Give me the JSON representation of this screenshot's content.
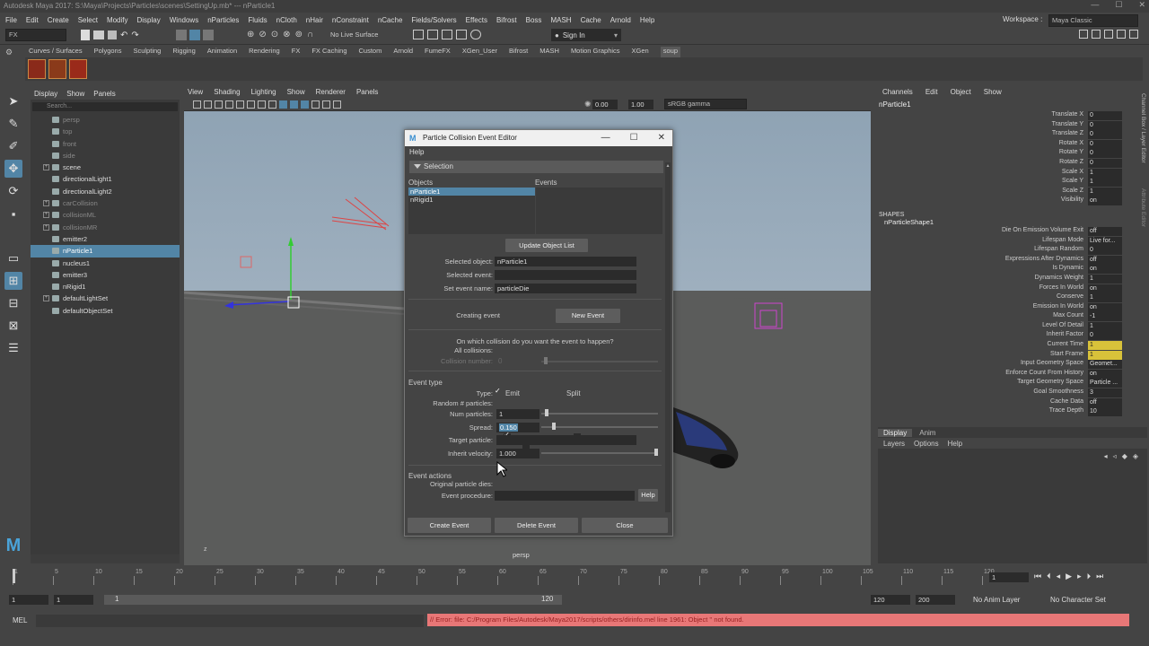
{
  "window": {
    "title": "Autodesk Maya 2017: S:\\Maya\\Projects\\Particles\\scenes\\SettingUp.mb* --- nParticle1",
    "min": "—",
    "max": "☐",
    "close": "✕"
  },
  "menubar": {
    "items": [
      "File",
      "Edit",
      "Create",
      "Select",
      "Modify",
      "Display",
      "Windows",
      "nParticles",
      "Fluids",
      "nCloth",
      "nHair",
      "nConstraint",
      "nCache",
      "Fields/Solvers",
      "Effects",
      "Bifrost",
      "Boss",
      "MASH",
      "Cache",
      "Arnold",
      "Help"
    ],
    "workspace_label": "Workspace :",
    "workspace_value": "Maya Classic"
  },
  "toolbar": {
    "mode": "FX",
    "live_surface": "No Live Surface",
    "sign_in": "Sign In"
  },
  "shelf": {
    "tabs": [
      "Curves / Surfaces",
      "Polygons",
      "Sculpting",
      "Rigging",
      "Animation",
      "Rendering",
      "FX",
      "FX Caching",
      "Custom",
      "Arnold",
      "FumeFX",
      "XGen_User",
      "Bifrost",
      "MASH",
      "Motion Graphics",
      "XGen",
      "soup"
    ],
    "active": "soup"
  },
  "outliner": {
    "menu": [
      "Display",
      "Show",
      "Panels"
    ],
    "search_placeholder": "Search...",
    "items": [
      {
        "label": "persp",
        "dim": true
      },
      {
        "label": "top",
        "dim": true
      },
      {
        "label": "front",
        "dim": true
      },
      {
        "label": "side",
        "dim": true
      },
      {
        "label": "scene",
        "expand": "+"
      },
      {
        "label": "directionalLight1"
      },
      {
        "label": "directionalLight2"
      },
      {
        "label": "carCollision",
        "dim": true,
        "expand": "+"
      },
      {
        "label": "collisionML",
        "dim": true,
        "expand": "+"
      },
      {
        "label": "collisionMR",
        "dim": true,
        "expand": "+"
      },
      {
        "label": "emitter2"
      },
      {
        "label": "nParticle1",
        "selected": true
      },
      {
        "label": "nucleus1"
      },
      {
        "label": "emitter3"
      },
      {
        "label": "nRigid1"
      },
      {
        "label": "defaultLightSet",
        "expand": "+"
      },
      {
        "label": "defaultObjectSet"
      }
    ]
  },
  "viewport": {
    "menu": [
      "View",
      "Shading",
      "Lighting",
      "Show",
      "Renderer",
      "Panels"
    ],
    "exposure": "0.00",
    "gamma": "1.00",
    "color_space": "sRGB gamma",
    "camera_label": "persp"
  },
  "channel_box": {
    "menu": [
      "Channels",
      "Edit",
      "Object",
      "Show"
    ],
    "node": "nParticle1",
    "transform": [
      {
        "n": "Translate X",
        "v": "0"
      },
      {
        "n": "Translate Y",
        "v": "0"
      },
      {
        "n": "Translate Z",
        "v": "0"
      },
      {
        "n": "Rotate X",
        "v": "0"
      },
      {
        "n": "Rotate Y",
        "v": "0"
      },
      {
        "n": "Rotate Z",
        "v": "0"
      },
      {
        "n": "Scale X",
        "v": "1"
      },
      {
        "n": "Scale Y",
        "v": "1"
      },
      {
        "n": "Scale Z",
        "v": "1"
      },
      {
        "n": "Visibility",
        "v": "on"
      }
    ],
    "shapes_label": "SHAPES",
    "shape_node": "nParticleShape1",
    "shape_attrs": [
      {
        "n": "Die On Emission Volume Exit",
        "v": "off"
      },
      {
        "n": "Lifespan Mode",
        "v": "Live for..."
      },
      {
        "n": "Lifespan Random",
        "v": "0"
      },
      {
        "n": "Expressions After Dynamics",
        "v": "off"
      },
      {
        "n": "Is Dynamic",
        "v": "on"
      },
      {
        "n": "Dynamics Weight",
        "v": "1"
      },
      {
        "n": "Forces In World",
        "v": "on"
      },
      {
        "n": "Conserve",
        "v": "1"
      },
      {
        "n": "Emission In World",
        "v": "on"
      },
      {
        "n": "Max Count",
        "v": "-1"
      },
      {
        "n": "Level Of Detail",
        "v": "1"
      },
      {
        "n": "Inherit Factor",
        "v": "0"
      },
      {
        "n": "Current Time",
        "v": "1",
        "hl": true
      },
      {
        "n": "Start Frame",
        "v": "1",
        "hl": true
      },
      {
        "n": "Input Geometry Space",
        "v": "Geomet..."
      },
      {
        "n": "Enforce Count From History",
        "v": "on"
      },
      {
        "n": "Target Geometry Space",
        "v": "Particle ..."
      },
      {
        "n": "Goal Smoothness",
        "v": "3"
      },
      {
        "n": "Cache Data",
        "v": "off"
      },
      {
        "n": "Trace Depth",
        "v": "10"
      }
    ],
    "side_tabs": [
      "Channel Box / Layer Editor",
      "Attribute Editor"
    ]
  },
  "layer_editor": {
    "tabs": [
      "Display",
      "Anim"
    ],
    "menu": [
      "Layers",
      "Options",
      "Help"
    ]
  },
  "timeline": {
    "ticks": [
      "1",
      "5",
      "10",
      "15",
      "20",
      "25",
      "30",
      "35",
      "40",
      "45",
      "50",
      "55",
      "60",
      "65",
      "70",
      "75",
      "80",
      "85",
      "90",
      "95",
      "100",
      "105",
      "110",
      "115",
      "120"
    ],
    "current_frame": "1"
  },
  "range": {
    "start": "1",
    "inner_start": "1",
    "slider_start": "1",
    "slider_end": "120",
    "end": "120",
    "max_end": "200",
    "anim_layer": "No Anim Layer",
    "character_set": "No Character Set"
  },
  "command": {
    "label": "MEL",
    "error": "// Error: file: C:/Program Files/Autodesk/Maya2017/scripts/others/dirinfo.mel line 1961: Object '' not found."
  },
  "dialog": {
    "title": "Particle Collision Event Editor",
    "menu": "Help",
    "section": "Selection",
    "objects_header": "Objects",
    "events_header": "Events",
    "objects": [
      "nParticle1",
      "nRigid1"
    ],
    "update_button": "Update Object List",
    "selected_object_label": "Selected object:",
    "selected_object": "nParticle1",
    "selected_event_label": "Selected event:",
    "selected_event": "",
    "set_event_name_label": "Set event name:",
    "set_event_name": "particleDie",
    "creating_event_label": "Creating event",
    "new_event_button": "New Event",
    "collision_question": "On which collision do you want the event to happen?",
    "all_collisions_label": "All collisions:",
    "collision_number_label": "Collision number:",
    "collision_number": "0",
    "event_type_label": "Event type",
    "type_label": "Type:",
    "emit_label": "Emit",
    "split_label": "Split",
    "random_particles_label": "Random # particles:",
    "num_particles_label": "Num particles:",
    "num_particles": "1",
    "spread_label": "Spread:",
    "spread": "0.150",
    "target_particle_label": "Target particle:",
    "inherit_velocity_label": "Inherit velocity:",
    "inherit_velocity": "1.000",
    "event_actions_label": "Event actions",
    "original_dies_label": "Original particle dies:",
    "event_procedure_label": "Event procedure:",
    "help_button": "Help",
    "create_button": "Create Event",
    "delete_button": "Delete Event",
    "close_button": "Close"
  }
}
